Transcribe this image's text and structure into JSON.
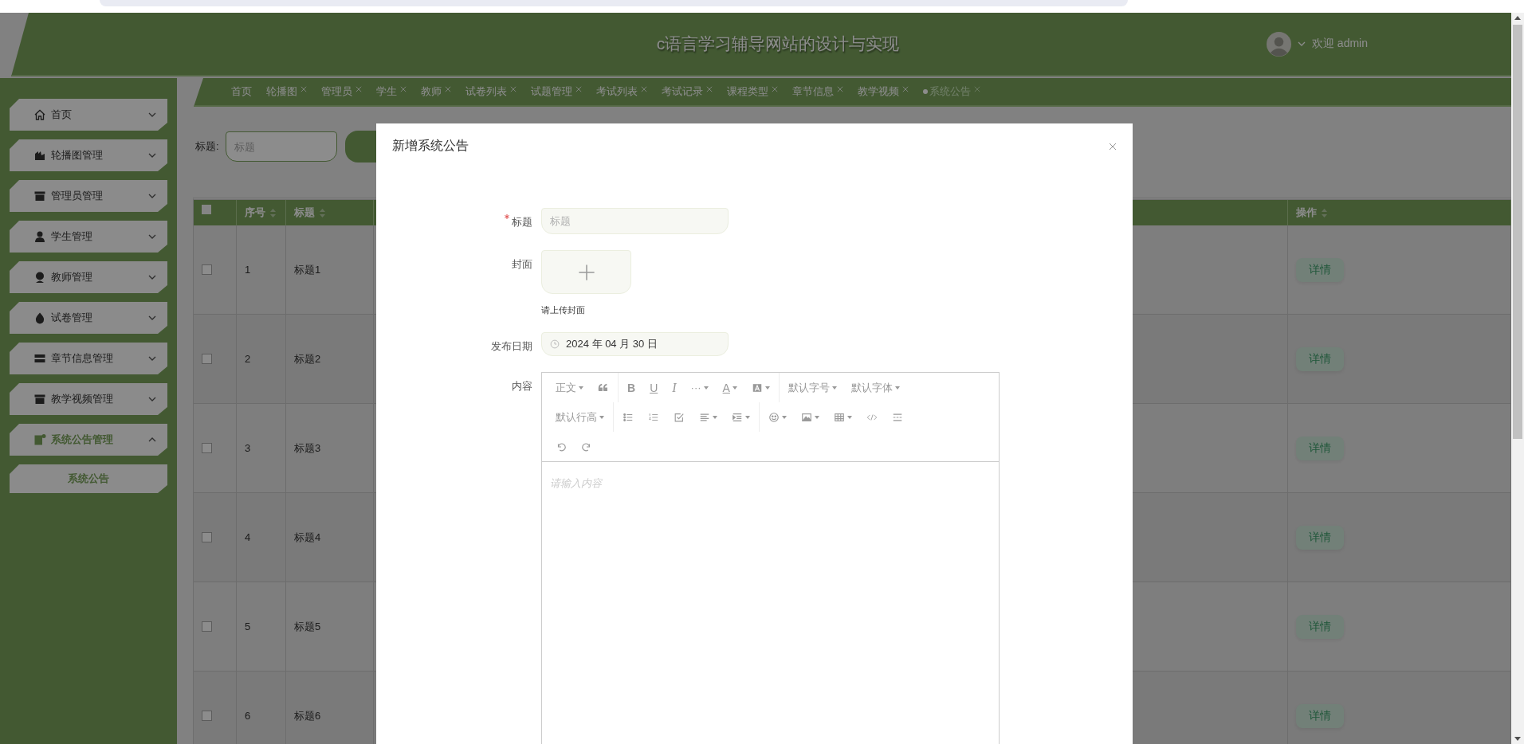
{
  "header": {
    "title": "c语言学习辅导网站的设计与实现",
    "welcome": "欢迎 admin"
  },
  "tabs": [
    {
      "label": "首页",
      "closable": false,
      "selected": false
    },
    {
      "label": "轮播图",
      "closable": true,
      "selected": false
    },
    {
      "label": "管理员",
      "closable": true,
      "selected": false
    },
    {
      "label": "学生",
      "closable": true,
      "selected": false
    },
    {
      "label": "教师",
      "closable": true,
      "selected": false
    },
    {
      "label": "试卷列表",
      "closable": true,
      "selected": false
    },
    {
      "label": "试题管理",
      "closable": true,
      "selected": false
    },
    {
      "label": "考试列表",
      "closable": true,
      "selected": false
    },
    {
      "label": "考试记录",
      "closable": true,
      "selected": false
    },
    {
      "label": "课程类型",
      "closable": true,
      "selected": false
    },
    {
      "label": "章节信息",
      "closable": true,
      "selected": false
    },
    {
      "label": "教学视频",
      "closable": true,
      "selected": false
    },
    {
      "label": "系统公告",
      "closable": true,
      "selected": true
    }
  ],
  "sidebar": {
    "items": [
      {
        "label": "首页",
        "expanded": false
      },
      {
        "label": "轮播图管理",
        "expanded": false
      },
      {
        "label": "管理员管理",
        "expanded": false
      },
      {
        "label": "学生管理",
        "expanded": false
      },
      {
        "label": "教师管理",
        "expanded": false
      },
      {
        "label": "试卷管理",
        "expanded": false
      },
      {
        "label": "章节信息管理",
        "expanded": false
      },
      {
        "label": "教学视频管理",
        "expanded": false
      },
      {
        "label": "系统公告管理",
        "expanded": true,
        "children": [
          {
            "label": "系统公告",
            "selected": true
          }
        ]
      }
    ]
  },
  "search": {
    "label": "标题:",
    "placeholder": "标题"
  },
  "table": {
    "all_checked": false,
    "columns": [
      "序号",
      "标题",
      "操作"
    ],
    "rows": [
      {
        "checked": false,
        "index": "1",
        "title": "标题1",
        "action": "详情"
      },
      {
        "checked": false,
        "index": "2",
        "title": "标题2",
        "action": "详情"
      },
      {
        "checked": false,
        "index": "3",
        "title": "标题3",
        "action": "详情"
      },
      {
        "checked": false,
        "index": "4",
        "title": "标题4",
        "action": "详情"
      },
      {
        "checked": false,
        "index": "5",
        "title": "标题5",
        "action": "详情"
      },
      {
        "checked": false,
        "index": "6",
        "title": "标题6",
        "action": "详情"
      }
    ]
  },
  "modal": {
    "title": "新增系统公告",
    "fields": [
      {
        "kind": "text",
        "label": "标题",
        "required": true,
        "placeholder": "标题"
      },
      {
        "kind": "upload",
        "label": "封面",
        "required": false,
        "hint": "请上传封面"
      },
      {
        "kind": "date",
        "label": "发布日期",
        "required": false,
        "value": "2024 年 04 月 30 日"
      },
      {
        "kind": "editor",
        "label": "内容",
        "required": false,
        "placeholder": "请输入内容",
        "toolbar": [
          {
            "groups": [
              [
                {
                  "kind": "menu",
                  "label": "正文",
                  "dropdown": true
                },
                {
                  "kind": "icon",
                  "dropdown": false
                }
              ],
              [
                {
                  "kind": "bold",
                  "label": "B",
                  "dropdown": false
                },
                {
                  "kind": "underline",
                  "label": "U",
                  "dropdown": false
                },
                {
                  "kind": "italic",
                  "label": "I",
                  "dropdown": false
                },
                {
                  "kind": "glyph",
                  "label": "···",
                  "dropdown": true
                },
                {
                  "kind": "underline",
                  "label": "A",
                  "dropdown": true
                },
                {
                  "kind": "icon",
                  "dropdown": true
                }
              ],
              [
                {
                  "kind": "menu",
                  "label": "默认字号",
                  "dropdown": true
                },
                {
                  "kind": "menu",
                  "label": "默认字体",
                  "dropdown": true
                }
              ]
            ]
          },
          {
            "groups": [
              [
                {
                  "kind": "menu",
                  "label": "默认行高",
                  "dropdown": true
                }
              ],
              [
                {
                  "kind": "icon",
                  "dropdown": false
                },
                {
                  "kind": "icon",
                  "dropdown": false
                },
                {
                  "kind": "icon",
                  "dropdown": false
                },
                {
                  "kind": "icon",
                  "dropdown": true
                },
                {
                  "kind": "icon",
                  "dropdown": true
                }
              ],
              [
                {
                  "kind": "icon",
                  "dropdown": true
                },
                {
                  "kind": "icon",
                  "dropdown": true
                },
                {
                  "kind": "icon",
                  "dropdown": true
                },
                {
                  "kind": "icon",
                  "dropdown": false
                },
                {
                  "kind": "icon",
                  "dropdown": false
                }
              ]
            ]
          },
          {
            "groups": [
              [
                {
                  "kind": "icon",
                  "dropdown": false
                },
                {
                  "kind": "icon",
                  "dropdown": false
                }
              ]
            ]
          }
        ]
      }
    ]
  }
}
